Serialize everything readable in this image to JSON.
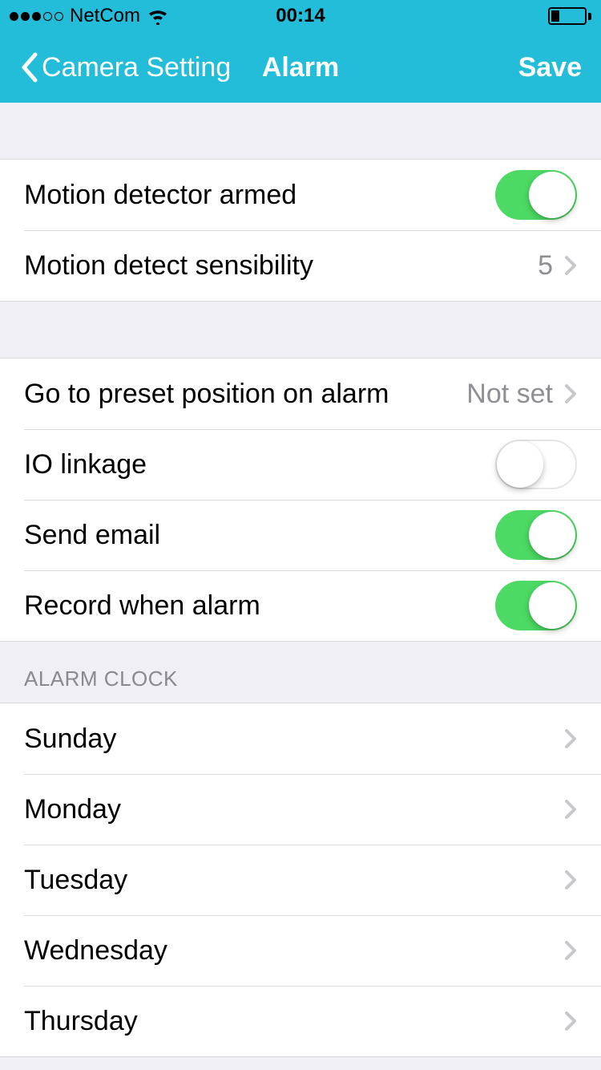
{
  "status_bar": {
    "carrier": "NetCom",
    "time": "00:14"
  },
  "nav": {
    "back_label": "Camera Setting",
    "title": "Alarm",
    "save_label": "Save"
  },
  "section1": {
    "motion_armed_label": "Motion detector armed",
    "sensibility_label": "Motion detect sensibility",
    "sensibility_value": "5"
  },
  "section2": {
    "preset_label": "Go to preset position on alarm",
    "preset_value": "Not set",
    "io_label": "IO linkage",
    "email_label": "Send email",
    "record_label": "Record when alarm"
  },
  "alarm_clock_header": "ALARM CLOCK",
  "days": {
    "sunday": "Sunday",
    "monday": "Monday",
    "tuesday": "Tuesday",
    "wednesday": "Wednesday",
    "thursday": "Thursday"
  },
  "toggles": {
    "motion_armed": true,
    "io_linkage": false,
    "send_email": true,
    "record_alarm": true
  }
}
